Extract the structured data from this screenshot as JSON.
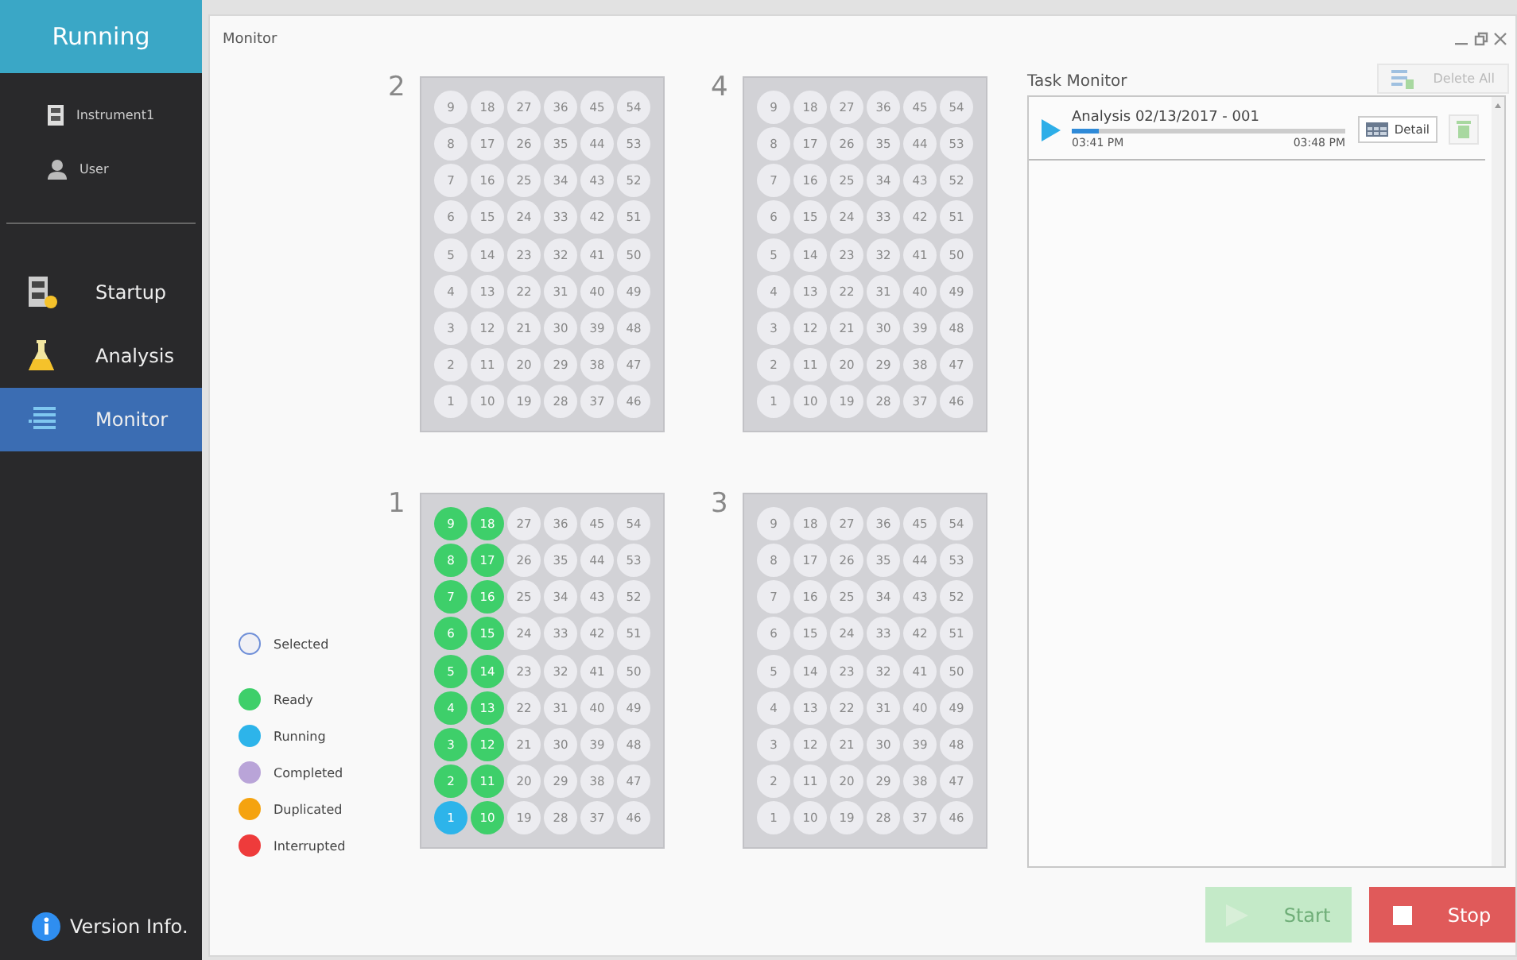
{
  "sidebar": {
    "status": "Running",
    "info": [
      {
        "kind": "instrument",
        "label": "Instrument1"
      },
      {
        "kind": "user",
        "label": "User"
      }
    ],
    "items": [
      {
        "kind": "startup",
        "label": "Startup",
        "selected": false
      },
      {
        "kind": "analysis",
        "label": "Analysis",
        "selected": false
      },
      {
        "kind": "monitor",
        "label": "Monitor",
        "selected": true
      }
    ],
    "footer": "Version Info."
  },
  "window": {
    "title": "Monitor"
  },
  "legend": [
    {
      "kind": "outline",
      "label": "Selected",
      "color": "#6f8fd8"
    },
    {
      "kind": "fill",
      "label": "Ready",
      "color": "#3ecf6a"
    },
    {
      "kind": "fill",
      "label": "Running",
      "color": "#2db4ea"
    },
    {
      "kind": "fill",
      "label": "Completed",
      "color": "#b9a4d8"
    },
    {
      "kind": "fill",
      "label": "Duplicated",
      "color": "#f5a30f"
    },
    {
      "kind": "fill",
      "label": "Interrupted",
      "color": "#ee3b3b"
    }
  ],
  "plates": [
    {
      "label": "2",
      "rows": [
        [
          {
            "label": "9"
          },
          {
            "label": "18"
          },
          {
            "label": "27"
          },
          {
            "label": "36"
          },
          {
            "label": "45"
          },
          {
            "label": "54"
          }
        ],
        [
          {
            "label": "8"
          },
          {
            "label": "17"
          },
          {
            "label": "26"
          },
          {
            "label": "35"
          },
          {
            "label": "44"
          },
          {
            "label": "53"
          }
        ],
        [
          {
            "label": "7"
          },
          {
            "label": "16"
          },
          {
            "label": "25"
          },
          {
            "label": "34"
          },
          {
            "label": "43"
          },
          {
            "label": "52"
          }
        ],
        [
          {
            "label": "6"
          },
          {
            "label": "15"
          },
          {
            "label": "24"
          },
          {
            "label": "33"
          },
          {
            "label": "42"
          },
          {
            "label": "51"
          }
        ],
        [
          {
            "label": "5"
          },
          {
            "label": "14"
          },
          {
            "label": "23"
          },
          {
            "label": "32"
          },
          {
            "label": "41"
          },
          {
            "label": "50"
          }
        ],
        [
          {
            "label": "4"
          },
          {
            "label": "13"
          },
          {
            "label": "22"
          },
          {
            "label": "31"
          },
          {
            "label": "40"
          },
          {
            "label": "49"
          }
        ],
        [
          {
            "label": "3"
          },
          {
            "label": "12"
          },
          {
            "label": "21"
          },
          {
            "label": "30"
          },
          {
            "label": "39"
          },
          {
            "label": "48"
          }
        ],
        [
          {
            "label": "2"
          },
          {
            "label": "11"
          },
          {
            "label": "20"
          },
          {
            "label": "29"
          },
          {
            "label": "38"
          },
          {
            "label": "47"
          }
        ],
        [
          {
            "label": "1"
          },
          {
            "label": "10"
          },
          {
            "label": "19"
          },
          {
            "label": "28"
          },
          {
            "label": "37"
          },
          {
            "label": "46"
          }
        ]
      ]
    },
    {
      "label": "4",
      "rows": [
        [
          {
            "label": "9"
          },
          {
            "label": "18"
          },
          {
            "label": "27"
          },
          {
            "label": "36"
          },
          {
            "label": "45"
          },
          {
            "label": "54"
          }
        ],
        [
          {
            "label": "8"
          },
          {
            "label": "17"
          },
          {
            "label": "26"
          },
          {
            "label": "35"
          },
          {
            "label": "44"
          },
          {
            "label": "53"
          }
        ],
        [
          {
            "label": "7"
          },
          {
            "label": "16"
          },
          {
            "label": "25"
          },
          {
            "label": "34"
          },
          {
            "label": "43"
          },
          {
            "label": "52"
          }
        ],
        [
          {
            "label": "6"
          },
          {
            "label": "15"
          },
          {
            "label": "24"
          },
          {
            "label": "33"
          },
          {
            "label": "42"
          },
          {
            "label": "51"
          }
        ],
        [
          {
            "label": "5"
          },
          {
            "label": "14"
          },
          {
            "label": "23"
          },
          {
            "label": "32"
          },
          {
            "label": "41"
          },
          {
            "label": "50"
          }
        ],
        [
          {
            "label": "4"
          },
          {
            "label": "13"
          },
          {
            "label": "22"
          },
          {
            "label": "31"
          },
          {
            "label": "40"
          },
          {
            "label": "49"
          }
        ],
        [
          {
            "label": "3"
          },
          {
            "label": "12"
          },
          {
            "label": "21"
          },
          {
            "label": "30"
          },
          {
            "label": "39"
          },
          {
            "label": "48"
          }
        ],
        [
          {
            "label": "2"
          },
          {
            "label": "11"
          },
          {
            "label": "20"
          },
          {
            "label": "29"
          },
          {
            "label": "38"
          },
          {
            "label": "47"
          }
        ],
        [
          {
            "label": "1"
          },
          {
            "label": "10"
          },
          {
            "label": "19"
          },
          {
            "label": "28"
          },
          {
            "label": "37"
          },
          {
            "label": "46"
          }
        ]
      ]
    },
    {
      "label": "1",
      "rows": [
        [
          {
            "label": "9",
            "color": "#3ecf6a"
          },
          {
            "label": "18",
            "color": "#3ecf6a"
          },
          {
            "label": "27"
          },
          {
            "label": "36"
          },
          {
            "label": "45"
          },
          {
            "label": "54"
          }
        ],
        [
          {
            "label": "8",
            "color": "#3ecf6a"
          },
          {
            "label": "17",
            "color": "#3ecf6a"
          },
          {
            "label": "26"
          },
          {
            "label": "35"
          },
          {
            "label": "44"
          },
          {
            "label": "53"
          }
        ],
        [
          {
            "label": "7",
            "color": "#3ecf6a"
          },
          {
            "label": "16",
            "color": "#3ecf6a"
          },
          {
            "label": "25"
          },
          {
            "label": "34"
          },
          {
            "label": "43"
          },
          {
            "label": "52"
          }
        ],
        [
          {
            "label": "6",
            "color": "#3ecf6a"
          },
          {
            "label": "15",
            "color": "#3ecf6a"
          },
          {
            "label": "24"
          },
          {
            "label": "33"
          },
          {
            "label": "42"
          },
          {
            "label": "51"
          }
        ],
        [
          {
            "label": "5",
            "color": "#3ecf6a"
          },
          {
            "label": "14",
            "color": "#3ecf6a"
          },
          {
            "label": "23"
          },
          {
            "label": "32"
          },
          {
            "label": "41"
          },
          {
            "label": "50"
          }
        ],
        [
          {
            "label": "4",
            "color": "#3ecf6a"
          },
          {
            "label": "13",
            "color": "#3ecf6a"
          },
          {
            "label": "22"
          },
          {
            "label": "31"
          },
          {
            "label": "40"
          },
          {
            "label": "49"
          }
        ],
        [
          {
            "label": "3",
            "color": "#3ecf6a"
          },
          {
            "label": "12",
            "color": "#3ecf6a"
          },
          {
            "label": "21"
          },
          {
            "label": "30"
          },
          {
            "label": "39"
          },
          {
            "label": "48"
          }
        ],
        [
          {
            "label": "2",
            "color": "#3ecf6a"
          },
          {
            "label": "11",
            "color": "#3ecf6a"
          },
          {
            "label": "20"
          },
          {
            "label": "29"
          },
          {
            "label": "38"
          },
          {
            "label": "47"
          }
        ],
        [
          {
            "label": "1",
            "color": "#2db4ea"
          },
          {
            "label": "10",
            "color": "#3ecf6a"
          },
          {
            "label": "19"
          },
          {
            "label": "28"
          },
          {
            "label": "37"
          },
          {
            "label": "46"
          }
        ]
      ]
    },
    {
      "label": "3",
      "rows": [
        [
          {
            "label": "9"
          },
          {
            "label": "18"
          },
          {
            "label": "27"
          },
          {
            "label": "36"
          },
          {
            "label": "45"
          },
          {
            "label": "54"
          }
        ],
        [
          {
            "label": "8"
          },
          {
            "label": "17"
          },
          {
            "label": "26"
          },
          {
            "label": "35"
          },
          {
            "label": "44"
          },
          {
            "label": "53"
          }
        ],
        [
          {
            "label": "7"
          },
          {
            "label": "16"
          },
          {
            "label": "25"
          },
          {
            "label": "34"
          },
          {
            "label": "43"
          },
          {
            "label": "52"
          }
        ],
        [
          {
            "label": "6"
          },
          {
            "label": "15"
          },
          {
            "label": "24"
          },
          {
            "label": "33"
          },
          {
            "label": "42"
          },
          {
            "label": "51"
          }
        ],
        [
          {
            "label": "5"
          },
          {
            "label": "14"
          },
          {
            "label": "23"
          },
          {
            "label": "32"
          },
          {
            "label": "41"
          },
          {
            "label": "50"
          }
        ],
        [
          {
            "label": "4"
          },
          {
            "label": "13"
          },
          {
            "label": "22"
          },
          {
            "label": "31"
          },
          {
            "label": "40"
          },
          {
            "label": "49"
          }
        ],
        [
          {
            "label": "3"
          },
          {
            "label": "12"
          },
          {
            "label": "21"
          },
          {
            "label": "30"
          },
          {
            "label": "39"
          },
          {
            "label": "48"
          }
        ],
        [
          {
            "label": "2"
          },
          {
            "label": "11"
          },
          {
            "label": "20"
          },
          {
            "label": "29"
          },
          {
            "label": "38"
          },
          {
            "label": "47"
          }
        ],
        [
          {
            "label": "1"
          },
          {
            "label": "10"
          },
          {
            "label": "19"
          },
          {
            "label": "28"
          },
          {
            "label": "37"
          },
          {
            "label": "46"
          }
        ]
      ]
    }
  ],
  "task_monitor": {
    "title": "Task Monitor",
    "delete_all": {
      "label": "Delete All",
      "disabled": true
    },
    "tasks": [
      {
        "name": "Analysis 02/13/2017 - 001",
        "level": 0.1,
        "start": "03:41 PM",
        "end": "03:48 PM",
        "detail": "Detail"
      }
    ]
  },
  "buttons": [
    {
      "kind": "start",
      "label": "Start",
      "disabled": true
    },
    {
      "kind": "stop",
      "label": "Stop",
      "disabled": false
    }
  ]
}
